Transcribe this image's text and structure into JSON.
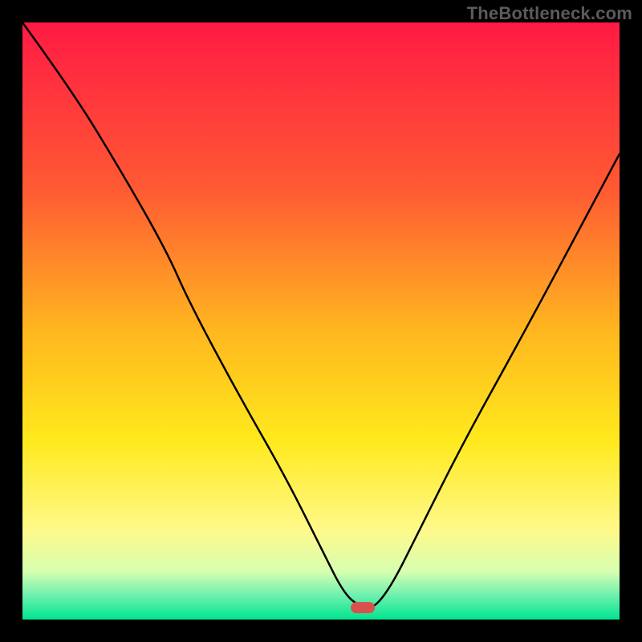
{
  "watermark": "TheBottleneck.com",
  "chart_data": {
    "type": "line",
    "title": "",
    "xlabel": "",
    "ylabel": "",
    "xlim": [
      0,
      100
    ],
    "ylim": [
      0,
      100
    ],
    "grid": false,
    "legend": false,
    "background_gradient": {
      "stops": [
        {
          "offset": 0,
          "color": "#ff1a44"
        },
        {
          "offset": 28,
          "color": "#ff5a33"
        },
        {
          "offset": 52,
          "color": "#ffb81f"
        },
        {
          "offset": 70,
          "color": "#ffe91d"
        },
        {
          "offset": 85,
          "color": "#fff98a"
        },
        {
          "offset": 92,
          "color": "#d6ffb0"
        },
        {
          "offset": 96,
          "color": "#6cf0ae"
        },
        {
          "offset": 100,
          "color": "#00e58f"
        }
      ]
    },
    "marker": {
      "x": 57,
      "y": 98,
      "color": "#d9514e"
    },
    "series": [
      {
        "name": "bottleneck-curve",
        "x": [
          0,
          8,
          16,
          24,
          28,
          36,
          44,
          50,
          54,
          57,
          59,
          62,
          66,
          74,
          84,
          100
        ],
        "values": [
          100,
          89,
          76,
          62,
          53,
          38,
          24,
          12,
          4,
          2,
          2,
          6,
          14,
          30,
          48,
          78
        ]
      }
    ]
  }
}
